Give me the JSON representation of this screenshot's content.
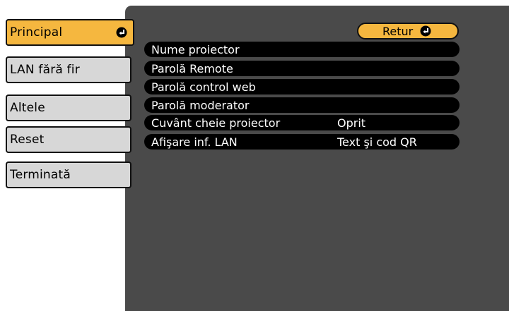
{
  "sidebar": {
    "items": [
      {
        "label": "Principal",
        "active": true
      },
      {
        "label": "LAN fără fir"
      },
      {
        "label": "Altele"
      },
      {
        "label": "Reset"
      },
      {
        "label": "Terminată"
      }
    ]
  },
  "main": {
    "back_label": "Retur",
    "rows": [
      {
        "label": "Nume proiector",
        "value": ""
      },
      {
        "label": "Parolă Remote",
        "value": ""
      },
      {
        "label": "Parolă control web",
        "value": ""
      },
      {
        "label": "Parolă moderator",
        "value": ""
      },
      {
        "label": "Cuvânt cheie proiector",
        "value": "Oprit"
      },
      {
        "label": "Afişare inf. LAN",
        "value": "Text şi cod QR"
      }
    ]
  },
  "colors": {
    "accent": "#f5b73f",
    "panel": "#4a4a4a",
    "tab": "#d7d7d7"
  }
}
